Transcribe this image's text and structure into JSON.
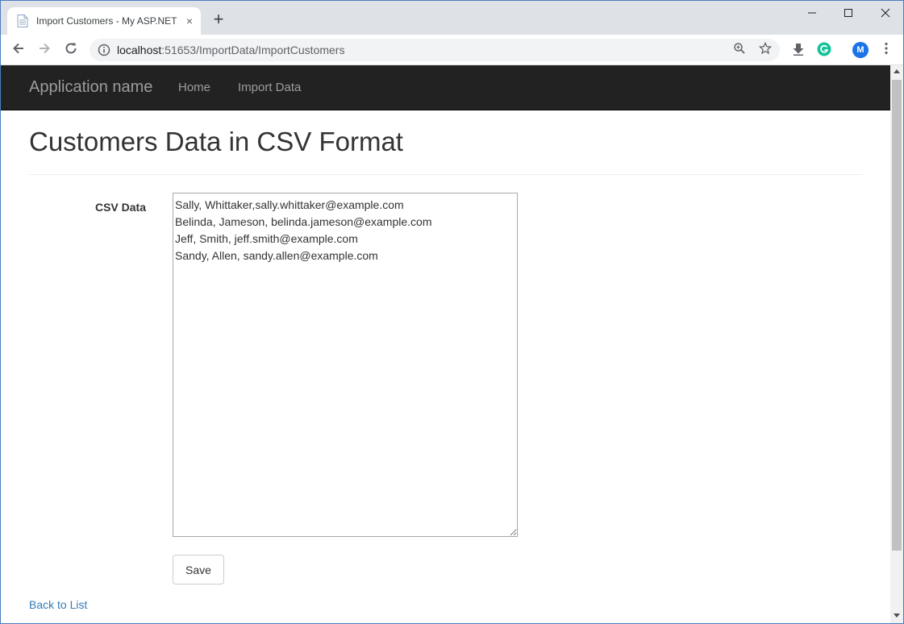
{
  "browser": {
    "tab_title": "Import Customers - My ASP.NET",
    "tab_close": "×",
    "new_tab": "+",
    "url_host": "localhost",
    "url_path": ":51653/ImportData/ImportCustomers",
    "profile_initial": "M",
    "icons": {
      "back": "arrow-left-icon",
      "forward": "arrow-right-icon",
      "reload": "reload-icon",
      "info": "info-icon",
      "zoom": "zoom-icon",
      "bookmark": "star-icon",
      "download": "download-icon",
      "grammarly": "grammarly-icon",
      "menu": "kebab-menu-icon"
    }
  },
  "navbar": {
    "brand": "Application name",
    "links": [
      "Home",
      "Import Data"
    ]
  },
  "page": {
    "title": "Customers Data in CSV Format",
    "csv_label": "CSV Data",
    "csv_value": "Sally, Whittaker,sally.whittaker@example.com\nBelinda, Jameson, belinda.jameson@example.com\nJeff, Smith, jeff.smith@example.com\nSandy, Allen, sandy.allen@example.com",
    "save_label": "Save",
    "back_link": "Back to List"
  },
  "colors": {
    "navbar_bg": "#222222",
    "link": "#337ab7",
    "tabstrip_bg": "#dee1e6"
  }
}
